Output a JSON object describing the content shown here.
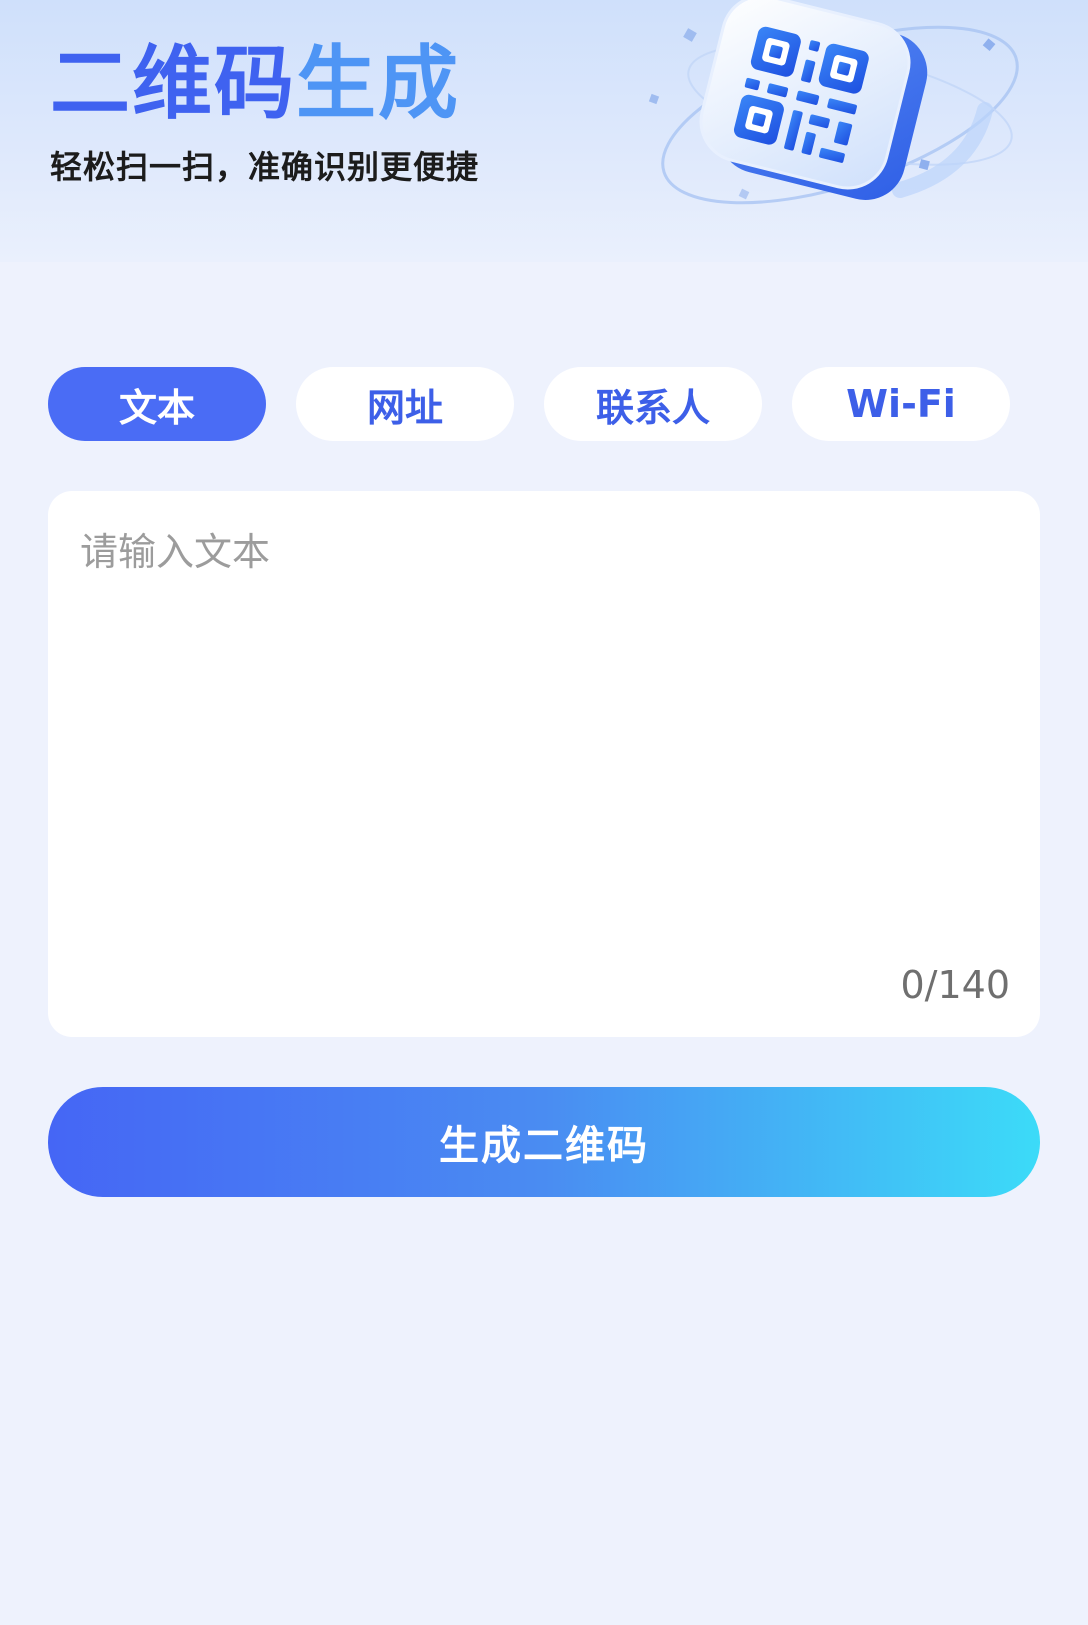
{
  "header": {
    "title_part1": "二维码",
    "title_part2": "生成",
    "subtitle": "轻松扫一扫，准确识别更便捷",
    "hero_icon": "qr-code-icon"
  },
  "tabs": [
    {
      "label": "文本",
      "active": true
    },
    {
      "label": "网址",
      "active": false
    },
    {
      "label": "联系人",
      "active": false
    },
    {
      "label": "Wi-Fi",
      "active": false
    }
  ],
  "input": {
    "placeholder": "请输入文本",
    "value": "",
    "counter": "0/140"
  },
  "actions": {
    "generate_label": "生成二维码"
  },
  "colors": {
    "primary": "#4a6cf5",
    "gradient_end": "#3cdbf8",
    "page_bg": "#eef2fd"
  }
}
